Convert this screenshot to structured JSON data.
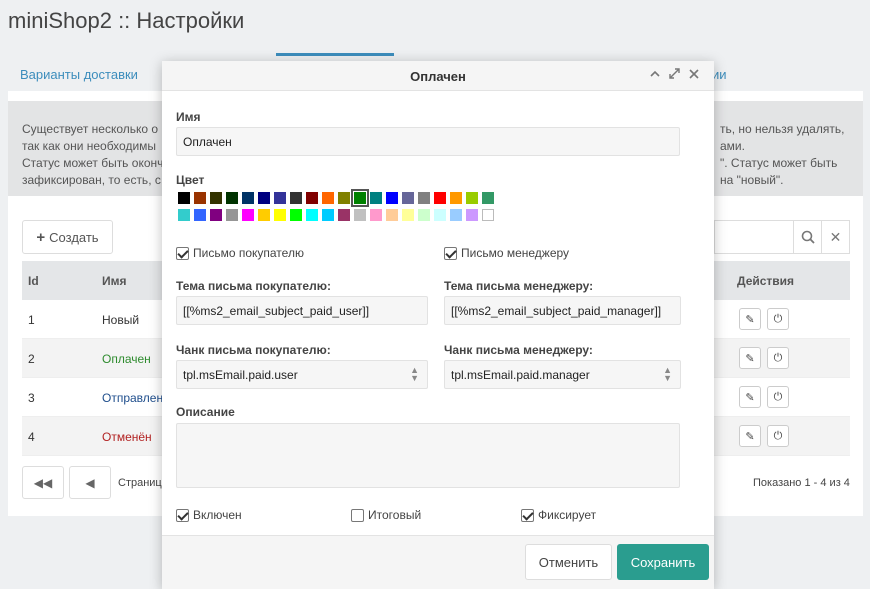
{
  "page": {
    "title": "miniShop2 :: Настройки"
  },
  "tabs": {
    "left_label": "Варианты доставки",
    "right_partial": "ии"
  },
  "info": {
    "lines": [
      {
        "left": "Существует несколько о",
        "right": "ть, но нельзя удалять,"
      },
      {
        "left": "так как они необходимы",
        "right": "ами."
      },
      {
        "left": "Статус может быть оконч",
        "right": "\". Статус может быть"
      },
      {
        "left": "зафиксирован, то есть, с",
        "right": "на \"новый\"."
      }
    ]
  },
  "toolbar": {
    "create_label": "Создать"
  },
  "grid": {
    "headers": {
      "id": "Id",
      "name": "Имя",
      "actions": "Действия"
    },
    "rows": [
      {
        "id": "1",
        "name": "Новый",
        "color": "#333333"
      },
      {
        "id": "2",
        "name": "Оплачен",
        "color": "#2e8b2e"
      },
      {
        "id": "3",
        "name": "Отправлен",
        "color": "#1f4e8c"
      },
      {
        "id": "4",
        "name": "Отменён",
        "color": "#b22222"
      }
    ]
  },
  "pager": {
    "page_label": "Страниц",
    "shown": "Показано 1 - 4 из 4"
  },
  "modal": {
    "title": "Оплачен",
    "name_label": "Имя",
    "name_value": "Оплачен",
    "color_label": "Цвет",
    "palette_row1": [
      "#000000",
      "#993300",
      "#333300",
      "#003300",
      "#003366",
      "#000080",
      "#333399",
      "#333333",
      "#800000",
      "#ff6600",
      "#808000",
      "#008000",
      "#008080",
      "#0000ff",
      "#666699",
      "#808080",
      "#ff0000",
      "#ff9900",
      "#99cc00",
      "#339966"
    ],
    "palette_row2": [
      "#33cccc",
      "#3366ff",
      "#800080",
      "#969696",
      "#ff00ff",
      "#ffcc00",
      "#ffff00",
      "#00ff00",
      "#00ffff",
      "#00ccff",
      "#993366",
      "#c0c0c0",
      "#ff99cc",
      "#ffcc99",
      "#ffff99",
      "#ccffcc",
      "#ccffff",
      "#99ccff",
      "#cc99ff",
      "#ffffff"
    ],
    "selected_color_index": 11,
    "checks": {
      "email_user": {
        "label": "Письмо покупателю",
        "checked": true
      },
      "email_manager": {
        "label": "Письмо менеджеру",
        "checked": true
      },
      "active": {
        "label": "Включен",
        "checked": true
      },
      "final": {
        "label": "Итоговый",
        "checked": false
      },
      "fixed": {
        "label": "Фиксирует",
        "checked": true
      }
    },
    "subject_user_label": "Тема письма покупателю:",
    "subject_user_value": "[[%ms2_email_subject_paid_user]]",
    "subject_manager_label": "Тема письма менеджеру:",
    "subject_manager_value": "[[%ms2_email_subject_paid_manager]]",
    "chunk_user_label": "Чанк письма покупателю:",
    "chunk_user_value": "tpl.msEmail.paid.user",
    "chunk_manager_label": "Чанк письма менеджеру:",
    "chunk_manager_value": "tpl.msEmail.paid.manager",
    "description_label": "Описание",
    "description_value": "",
    "cancel_label": "Отменить",
    "save_label": "Сохранить"
  }
}
